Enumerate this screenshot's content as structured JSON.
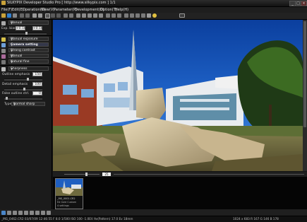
{
  "window": {
    "title": "SILKYPIX Developer Studio Pro [ http://www.silkypix.com ]   1/1",
    "controls": {
      "minimize": "_",
      "maximize": "□",
      "close": "×"
    }
  },
  "menu": [
    "File(F)",
    "Edit(E)",
    "Operation(O)",
    "View(V)",
    "Parameter(P)",
    "Development(D)",
    "Option(T)",
    "Help(H)"
  ],
  "left_panel": {
    "preset": "Manual",
    "exp_bias_label": "Exp. bias",
    "exp_bias_value": "+0.10",
    "exp_bias_value2": "+0.10",
    "wb_dropdown": "Manual exposure",
    "camera_setting": "Camera setting",
    "tone_dropdown": "Strong contrast",
    "color_dropdown": "Manual",
    "style_dropdown": "Natural fine",
    "sharpness_label": "Sharpness",
    "outline_label": "Outline emphasis",
    "outline_value": "150",
    "detail_label": "Detail emphasis",
    "detail_value": "100",
    "false_outline_label": "False outline ctrl.",
    "false_outline_value": "0",
    "type_label": "Type",
    "type_value": "Normal sharp"
  },
  "viewer": {
    "zoom_value": "25"
  },
  "thumbnail": {
    "caption_line1": "_MG_0001.CR2",
    "caption_line2": "Ed Gold Custom",
    "caption_line3": "4 settings"
  },
  "status": {
    "left": "_MG_0462.CR2 03/07/09 12:46:55 F 8.0 1/500 ISO 100   -1.0EV Av(Pattern) 17.0 Ev 18mm",
    "right": "1024 x 683   R 167   G 146   B 178"
  },
  "colors": {
    "accent_blue": "#1a8ad8",
    "panel_bg": "#1b1b1b"
  }
}
